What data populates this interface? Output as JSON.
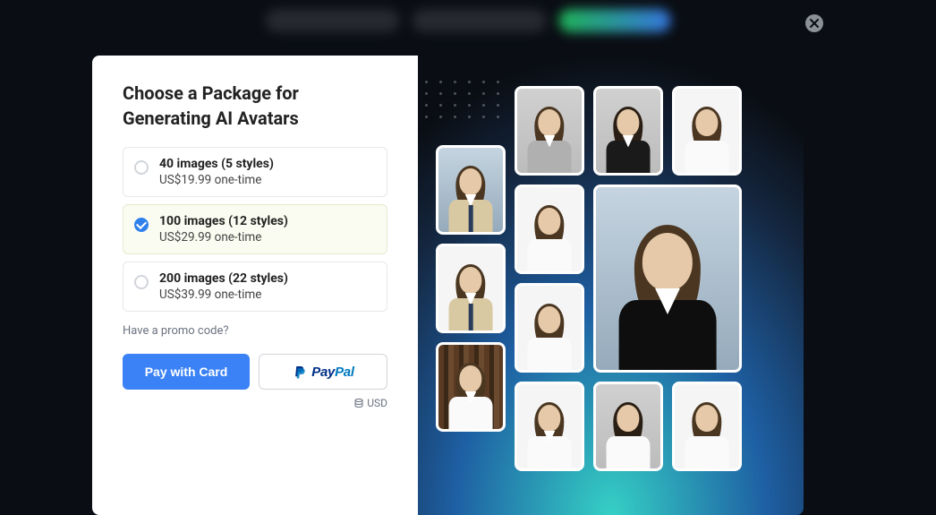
{
  "modal": {
    "title_line1": "Choose a Package for",
    "title_line2": "Generating AI Avatars",
    "options": [
      {
        "title": "40 images (5 styles)",
        "price": "US$19.99 one-time",
        "selected": false
      },
      {
        "title": "100 images (12 styles)",
        "price": "US$29.99 one-time",
        "selected": true
      },
      {
        "title": "200 images (22 styles)",
        "price": "US$39.99 one-time",
        "selected": false
      }
    ],
    "promo_label": "Have a promo code?",
    "pay_card_label": "Pay with Card",
    "paypal_prefix": "Pay",
    "paypal_suffix": "Pal",
    "currency_label": "USD",
    "close_icon": "close-icon"
  },
  "gallery": {
    "tiles": [
      {
        "pos": "t1",
        "bg": "bg-grey",
        "hair": "hair-brown",
        "torso": "t-suit-grey",
        "collar": true,
        "tie": false
      },
      {
        "pos": "t2",
        "bg": "bg-grey",
        "hair": "hair-dark",
        "torso": "t-suit-black",
        "collar": true,
        "tie": false
      },
      {
        "pos": "t3",
        "bg": "bg-white",
        "hair": "hair-brown",
        "torso": "t-shirt-white",
        "collar": false,
        "tie": false
      },
      {
        "pos": "t4",
        "bg": "bg-city",
        "hair": "hair-brown",
        "torso": "t-suit-beige",
        "collar": true,
        "tie": true
      },
      {
        "pos": "t5",
        "bg": "bg-white",
        "hair": "hair-brown",
        "torso": "t-shirt-white",
        "collar": false,
        "tie": false
      },
      {
        "pos": "t6",
        "bg": "bg-city",
        "hair": "hair-brown",
        "torso": "t-blazer-dark",
        "collar": true,
        "tie": false
      },
      {
        "pos": "t7",
        "bg": "bg-white",
        "hair": "hair-brown",
        "torso": "t-suit-beige",
        "collar": true,
        "tie": true
      },
      {
        "pos": "t8",
        "bg": "bg-white",
        "hair": "hair-brown",
        "torso": "t-shirt-white",
        "collar": false,
        "tie": false
      },
      {
        "pos": "t9",
        "bg": "bg-books",
        "hair": "hair-brown",
        "torso": "t-shirt-white",
        "collar": true,
        "tie": false
      },
      {
        "pos": "t10",
        "bg": "bg-white",
        "hair": "hair-brown",
        "torso": "t-shirt-white",
        "collar": true,
        "tie": false
      },
      {
        "pos": "t11",
        "bg": "bg-grey",
        "hair": "hair-dark",
        "torso": "t-shirt-white",
        "collar": false,
        "tie": false
      },
      {
        "pos": "t12",
        "bg": "bg-white",
        "hair": "hair-brown",
        "torso": "t-shirt-white",
        "collar": false,
        "tie": false
      }
    ]
  }
}
